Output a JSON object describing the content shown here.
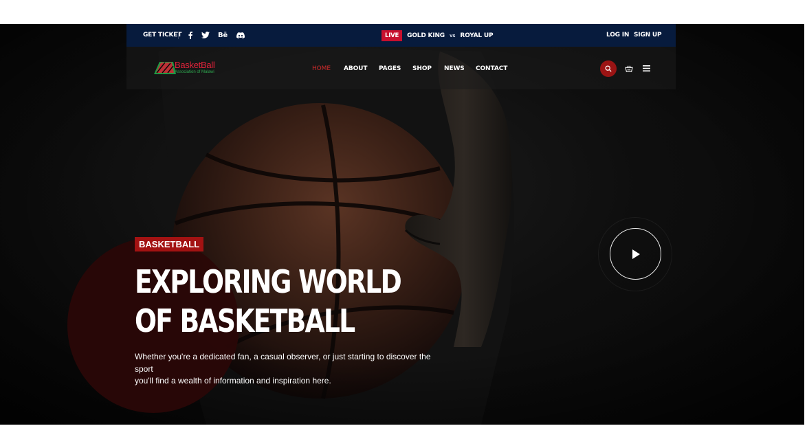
{
  "topbar": {
    "get_ticket": "GET TICKET",
    "social_icons": [
      "facebook-icon",
      "twitter-icon",
      "behance-icon",
      "discord-icon"
    ],
    "behance_label": "Bē",
    "live_label": "LIVE",
    "team_home": "GOLD KING",
    "vs_label": "vs",
    "team_away": "ROYAL UP",
    "login": "LOG IN",
    "signup": "SIGN UP"
  },
  "logo": {
    "title": "BasketBall",
    "subtitle": "Association of Malawi"
  },
  "nav": {
    "items": [
      {
        "label": "HOME",
        "active": true
      },
      {
        "label": "ABOUT",
        "active": false
      },
      {
        "label": "PAGES",
        "active": false
      },
      {
        "label": "SHOP",
        "active": false
      },
      {
        "label": "NEWS",
        "active": false
      },
      {
        "label": "CONTACT",
        "active": false
      }
    ]
  },
  "hero": {
    "badge": "BASKETBALL",
    "headline_line1": "EXPLORING WORLD",
    "headline_line2": "OF BASKETBALL",
    "subtext_line1": "Whether you're a dedicated fan, a casual observer, or just starting to discover the sport",
    "subtext_line2": "you'll find a wealth of information and inspiration here."
  },
  "colors": {
    "topbar_bg": "#071b3d",
    "accent_red": "#a31212",
    "live_red": "#c8102e",
    "hero_bg": "#0b0b0b"
  }
}
